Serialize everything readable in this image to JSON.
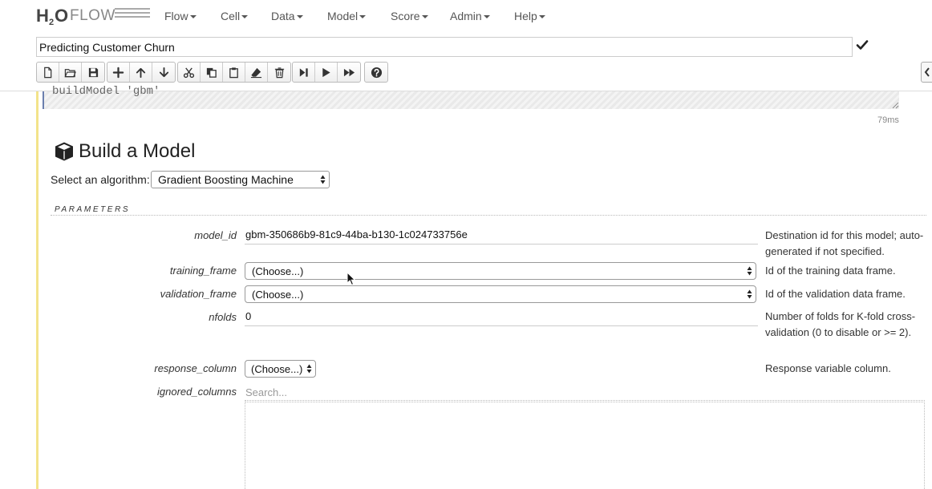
{
  "app": {
    "logo_h": "H",
    "logo_2": "2",
    "logo_o": "O",
    "logo_flow": "FLOW"
  },
  "nav": {
    "items": [
      "Flow",
      "Cell",
      "Data",
      "Model",
      "Score",
      "Admin",
      "Help"
    ]
  },
  "notebook": {
    "title": "Predicting Customer Churn"
  },
  "toolbar": {
    "icons": [
      "new-file-icon",
      "open-folder-icon",
      "save-icon",
      "add-cell-icon",
      "move-up-icon",
      "move-down-icon",
      "cut-icon",
      "copy-icon",
      "paste-icon",
      "eraser-icon",
      "delete-icon",
      "step-icon",
      "run-icon",
      "run-all-icon",
      "help-icon"
    ]
  },
  "cell": {
    "editor_text": "buildModel 'gbm'",
    "timing": "79ms"
  },
  "build": {
    "heading": "Build a Model",
    "algo_label": "Select an algorithm:",
    "algo_value": "Gradient Boosting Machine",
    "params_header": "PARAMETERS"
  },
  "params": {
    "model_id": {
      "label": "model_id",
      "value": "gbm-350686b9-81c9-44ba-b130-1c024733756e",
      "desc": "Destination id for this model; auto-generated if not specified."
    },
    "training_frame": {
      "label": "training_frame",
      "value": "(Choose...)",
      "desc": "Id of the training data frame."
    },
    "validation_frame": {
      "label": "validation_frame",
      "value": "(Choose...)",
      "desc": "Id of the validation data frame."
    },
    "nfolds": {
      "label": "nfolds",
      "value": "0",
      "desc": "Number of folds for K-fold cross-validation (0 to disable or >= 2)."
    },
    "response_column": {
      "label": "response_column",
      "value": "(Choose...)",
      "desc": "Response variable column."
    },
    "ignored_columns": {
      "label": "ignored_columns",
      "placeholder": "Search..."
    }
  },
  "colors": {
    "cell_bar": "#f3e38a",
    "editor_border": "#6b7fae"
  }
}
